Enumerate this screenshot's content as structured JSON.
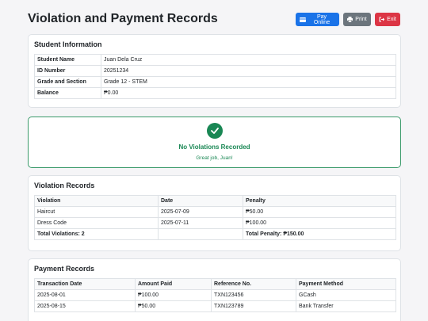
{
  "page": {
    "title": "Violation and Payment Records"
  },
  "toolbar": {
    "pay_label": "Pay Online",
    "print_label": "Print",
    "exit_label": "Exit"
  },
  "student_info": {
    "title": "Student Information",
    "rows": [
      {
        "label": "Student Name",
        "value": "Juan Dela Cruz"
      },
      {
        "label": "ID Number",
        "value": "20251234"
      },
      {
        "label": "Grade and Section",
        "value": "Grade 12 - STEM"
      },
      {
        "label": "Balance",
        "value": "₱0.00"
      }
    ]
  },
  "status": {
    "title": "No Violations Recorded",
    "message": "Great job, Juan!",
    "color": "#198754"
  },
  "violations": {
    "title": "Violation Records",
    "headers": [
      "Violation",
      "Date",
      "Penalty"
    ],
    "rows": [
      [
        "Haircut",
        "2025-07-09",
        "₱50.00"
      ],
      [
        "Dress Code",
        "2025-07-11",
        "₱100.00"
      ]
    ],
    "total_label": "Total Violations: 2",
    "total_penalty": "Total Penalty: ₱150.00"
  },
  "payments": {
    "title": "Payment Records",
    "headers": [
      "Transaction Date",
      "Amount Paid",
      "Reference No.",
      "Payment Method"
    ],
    "rows": [
      [
        "2025-08-01",
        "₱100.00",
        "TXN123456",
        "GCash"
      ],
      [
        "2025-08-15",
        "₱50.00",
        "TXN123789",
        "Bank Transfer"
      ]
    ]
  }
}
